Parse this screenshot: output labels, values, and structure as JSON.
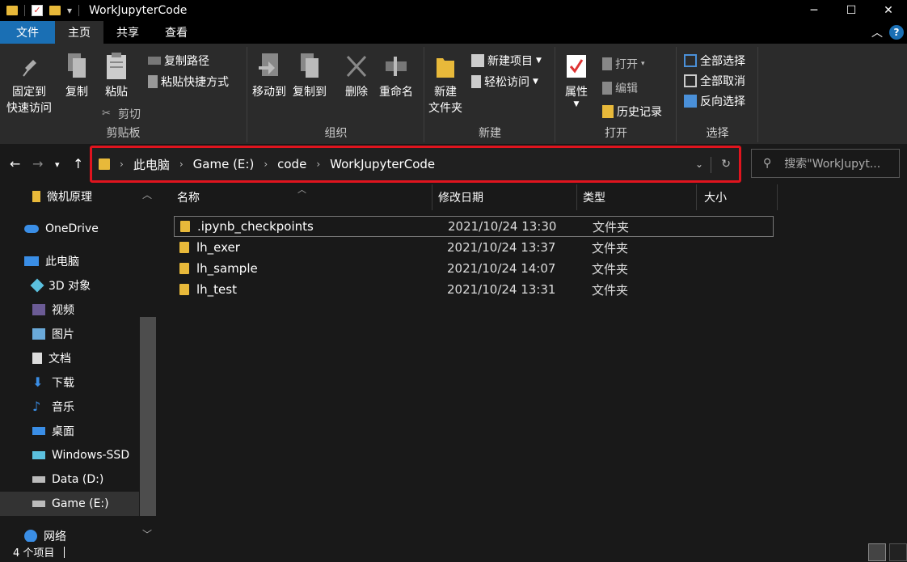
{
  "window": {
    "title": "WorkJupyterCode"
  },
  "tabs": {
    "file": "文件",
    "home": "主页",
    "share": "共享",
    "view": "查看"
  },
  "ribbon": {
    "clipboard": {
      "pin_line1": "固定到",
      "pin_line2": "快速访问",
      "copy": "复制",
      "paste": "粘贴",
      "copy_path": "复制路径",
      "paste_shortcut": "粘贴快捷方式",
      "cut": "剪切",
      "label": "剪贴板"
    },
    "organize": {
      "move_to": "移动到",
      "copy_to": "复制到",
      "delete": "删除",
      "rename": "重命名",
      "label": "组织"
    },
    "new": {
      "new_folder_line1": "新建",
      "new_folder_line2": "文件夹",
      "new_item": "新建项目",
      "easy_access": "轻松访问",
      "label": "新建"
    },
    "open": {
      "properties": "属性",
      "open": "打开",
      "edit": "编辑",
      "history": "历史记录",
      "label": "打开"
    },
    "select": {
      "select_all": "全部选择",
      "select_none": "全部取消",
      "invert": "反向选择",
      "label": "选择"
    }
  },
  "address": {
    "crumbs": [
      "此电脑",
      "Game (E:)",
      "code",
      "WorkJupyterCode"
    ],
    "highlight_color": "#e0141e"
  },
  "search": {
    "placeholder": "搜索\"WorkJupyt..."
  },
  "sidebar": {
    "items": [
      {
        "label": "微机原理",
        "icon": "folder-icon"
      },
      {
        "label": "OneDrive",
        "icon": "cloud-icon"
      },
      {
        "label": "此电脑",
        "icon": "computer-icon"
      },
      {
        "label": "3D 对象",
        "icon": "cube-icon"
      },
      {
        "label": "视频",
        "icon": "video-icon"
      },
      {
        "label": "图片",
        "icon": "picture-icon"
      },
      {
        "label": "文档",
        "icon": "document-icon"
      },
      {
        "label": "下载",
        "icon": "download-icon"
      },
      {
        "label": "音乐",
        "icon": "music-icon"
      },
      {
        "label": "桌面",
        "icon": "desktop-icon"
      },
      {
        "label": "Windows-SSD",
        "icon": "drive-icon"
      },
      {
        "label": "Data (D:)",
        "icon": "drive-icon"
      },
      {
        "label": "Game (E:)",
        "icon": "drive-icon"
      },
      {
        "label": "网络",
        "icon": "network-icon"
      }
    ]
  },
  "filelist": {
    "columns": [
      "名称",
      "修改日期",
      "类型",
      "大小"
    ],
    "rows": [
      {
        "name": ".ipynb_checkpoints",
        "date": "2021/10/24 13:30",
        "type": "文件夹"
      },
      {
        "name": "lh_exer",
        "date": "2021/10/24 13:37",
        "type": "文件夹"
      },
      {
        "name": "lh_sample",
        "date": "2021/10/24 14:07",
        "type": "文件夹"
      },
      {
        "name": "lh_test",
        "date": "2021/10/24 13:31",
        "type": "文件夹"
      }
    ]
  },
  "status": {
    "count": "4 个项目"
  }
}
